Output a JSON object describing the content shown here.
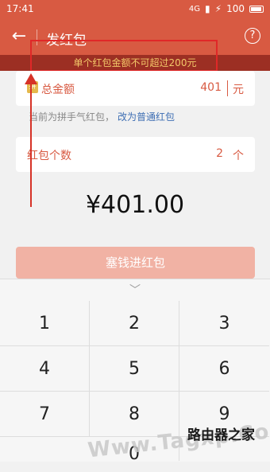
{
  "status_bar": {
    "time": "17:41",
    "battery": "100",
    "signal": "4G"
  },
  "title_bar": {
    "title": "发红包",
    "help": "?"
  },
  "warning": {
    "text": "单个红包金额不可超过200元"
  },
  "amount": {
    "icon": "拼",
    "label": "总金额",
    "value": "401",
    "unit": "元"
  },
  "hint": {
    "text": "当前为拼手气红包，",
    "link": "改为普通红包"
  },
  "count": {
    "label": "红包个数",
    "value": "2",
    "unit": "个"
  },
  "total_display": "¥401.00",
  "submit_label": "塞钱进红包",
  "keyboard": {
    "keys": [
      "1",
      "2",
      "3",
      "4",
      "5",
      "6",
      "7",
      "8",
      "9",
      "0"
    ]
  },
  "watermark": {
    "text": "Www.Tagxp.Com",
    "text2": "路由器之家"
  },
  "colors": {
    "accent": "#d85a42",
    "warn_bg": "#9c2f23",
    "warn_text": "#f3c869"
  }
}
